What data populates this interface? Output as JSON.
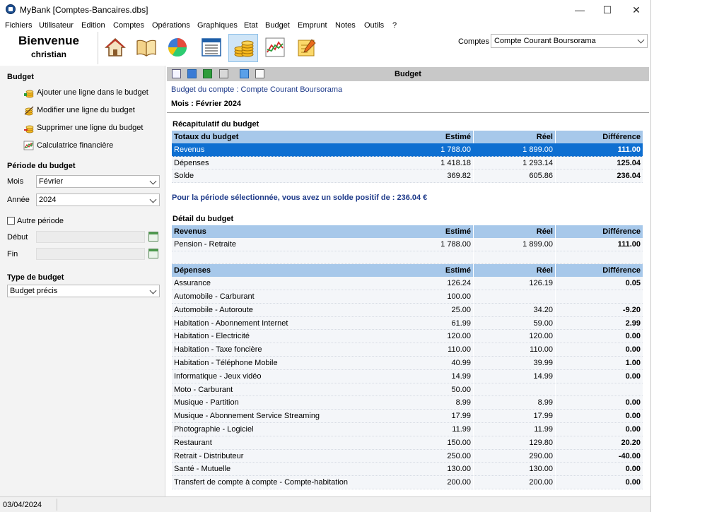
{
  "window": {
    "title": "MyBank [Comptes-Bancaires.dbs]",
    "controls": [
      "—",
      "☐",
      "✕"
    ]
  },
  "menu": [
    "Fichiers",
    "Utilisateur",
    "Edition",
    "Comptes",
    "Opérations",
    "Graphiques",
    "Etat",
    "Budget",
    "Emprunt",
    "Notes",
    "Outils",
    "?"
  ],
  "welcome": {
    "title": "Bienvenue",
    "user": "christian"
  },
  "toolbar": {
    "icons": [
      "home-icon",
      "book-icon",
      "pie-chart-icon",
      "list-icon",
      "coins-icon",
      "line-chart-icon",
      "notepad-icon"
    ],
    "active": "coins-icon",
    "accounts_label": "Comptes",
    "accounts_value": "Compte Courant Boursorama"
  },
  "sidebar": {
    "budget_header": "Budget",
    "actions": [
      "Ajouter une ligne dans le budget",
      "Modifier une ligne du budget",
      "Supprimer une ligne du budget",
      "Calculatrice financière"
    ],
    "period_header": "Période du budget",
    "month_label": "Mois",
    "month_value": "Février",
    "year_label": "Année",
    "year_value": "2024",
    "other_period_label": "Autre période",
    "start_label": "Début",
    "end_label": "Fin",
    "type_header": "Type de budget",
    "type_value": "Budget précis"
  },
  "content": {
    "toolbar_title": "Budget",
    "account_line": "Budget du compte : Compte Courant Boursorama",
    "month_line": "Mois : Février 2024",
    "summary_title": "Récapitulatif du budget",
    "summary_headers": [
      "Totaux du budget",
      "Estimé",
      "Réel",
      "Différence"
    ],
    "summary_rows": [
      [
        "Revenus",
        "1 788.00",
        "1 899.00",
        "111.00"
      ],
      [
        "Dépenses",
        "1 418.18",
        "1 293.14",
        "125.04"
      ],
      [
        "Solde",
        "369.82",
        "605.86",
        "236.04"
      ]
    ],
    "solde_message": "Pour la période sélectionnée, vous avez un solde positif de : 236.04 €",
    "detail_title": "Détail du budget",
    "revenus_headers": [
      "Revenus",
      "Estimé",
      "Réel",
      "Différence"
    ],
    "revenus_rows": [
      [
        "Pension - Retraite",
        "1 788.00",
        "1 899.00",
        "111.00"
      ]
    ],
    "depenses_headers": [
      "Dépenses",
      "Estimé",
      "Réel",
      "Différence"
    ],
    "depenses_rows": [
      [
        "Assurance",
        "126.24",
        "126.19",
        "0.05"
      ],
      [
        "Automobile - Carburant",
        "100.00",
        "",
        ""
      ],
      [
        "Automobile - Autoroute",
        "25.00",
        "34.20",
        "-9.20"
      ],
      [
        "Habitation - Abonnement Internet",
        "61.99",
        "59.00",
        "2.99"
      ],
      [
        "Habitation - Electricité",
        "120.00",
        "120.00",
        "0.00"
      ],
      [
        "Habitation - Taxe foncière",
        "110.00",
        "110.00",
        "0.00"
      ],
      [
        "Habitation - Téléphone Mobile",
        "40.99",
        "39.99",
        "1.00"
      ],
      [
        "Informatique - Jeux vidéo",
        "14.99",
        "14.99",
        "0.00"
      ],
      [
        "Moto - Carburant",
        "50.00",
        "",
        ""
      ],
      [
        "Musique - Partition",
        "8.99",
        "8.99",
        "0.00"
      ],
      [
        "Musique - Abonnement Service Streaming",
        "17.99",
        "17.99",
        "0.00"
      ],
      [
        "Photographie - Logiciel",
        "11.99",
        "11.99",
        "0.00"
      ],
      [
        "Restaurant",
        "150.00",
        "129.80",
        "20.20"
      ],
      [
        "Retrait - Distributeur",
        "250.00",
        "290.00",
        "-40.00"
      ],
      [
        "Santé - Mutuelle",
        "130.00",
        "130.00",
        "0.00"
      ],
      [
        "Transfert de compte à compte - Compte-habitation",
        "200.00",
        "200.00",
        "0.00"
      ]
    ]
  },
  "status": {
    "date": "03/04/2024"
  }
}
